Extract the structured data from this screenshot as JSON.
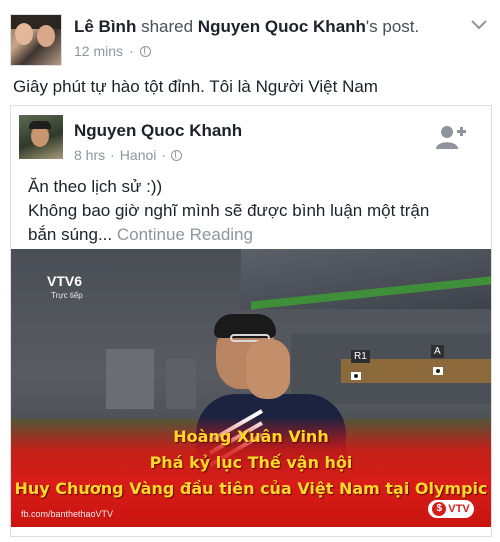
{
  "post": {
    "author": "Lê Bình",
    "action": "shared",
    "shared_from": "Nguyen Quoc Khanh",
    "possessive": "'s post.",
    "time": "12 mins",
    "dot": "·",
    "status_text": "Giây phút tự hào tột đỉnh. Tôi là Người Việt Nam"
  },
  "shared_post": {
    "author": "Nguyen Quoc Khanh",
    "time": "8 hrs",
    "location": "Hanoi",
    "dot": "·",
    "line1": "Ăn theo lịch sử :))",
    "line2": "Không bao giờ nghĩ mình sẽ được bình luận một trận",
    "line3": "bắn súng...",
    "continue_label": "Continue Reading"
  },
  "video": {
    "channel_logo": "VTV6",
    "live_label": "Trực tiếp",
    "lane_r1": "R1",
    "lane_a": "A",
    "caption_line1": "Hoàng Xuân Vinh",
    "caption_line2": "Phá kỷ lục Thế vận hội",
    "caption_line3": "Huy Chương Vàng đầu tiên của Việt Nam tại Olympic",
    "source": "fb.com/banthethaoVTV",
    "badge_symbol": "$",
    "badge_text": "VTV"
  },
  "icons": {
    "privacy": "globe-icon",
    "menu": "chevron-down-icon",
    "add_friend": "add-friend-icon"
  },
  "colors": {
    "text": "#1d2129",
    "muted": "#90949c",
    "caption": "#ffd92a",
    "banner": "#d81d18"
  }
}
